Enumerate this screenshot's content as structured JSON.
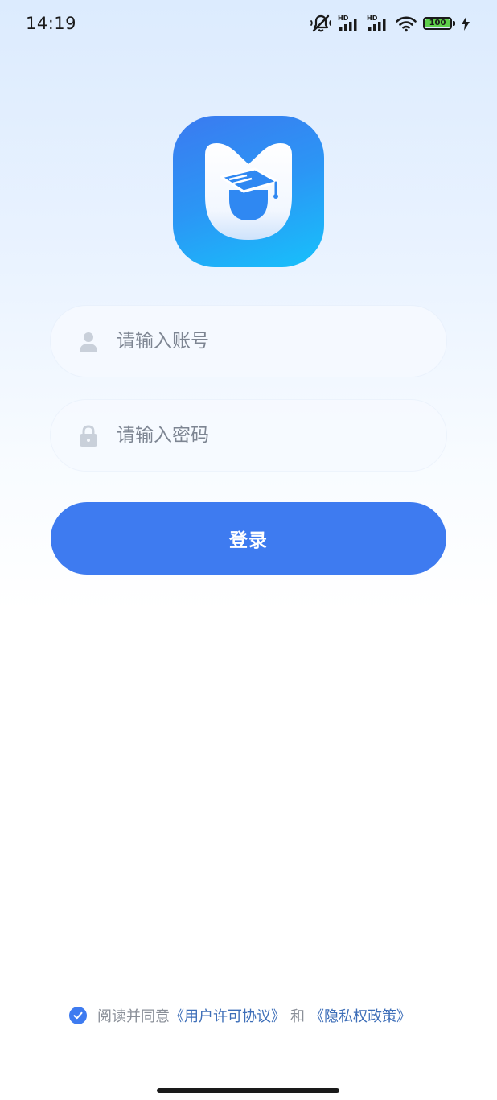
{
  "status_bar": {
    "time": "14:19",
    "battery_level": "100",
    "signal_1_label": "HD",
    "signal_2_label": "HD"
  },
  "form": {
    "account_placeholder": "请输入账号",
    "account_value": "",
    "password_placeholder": "请输入密码",
    "password_value": ""
  },
  "login_button": {
    "label": "登录"
  },
  "agreement": {
    "checked": true,
    "prefix": "阅读并同意",
    "user_license": "《用户许可协议》",
    "and": "和",
    "privacy_policy": "《隐私权政策》"
  },
  "icons": {
    "account": "user-icon",
    "password": "lock-icon",
    "logo": "graduation-cap-shield"
  },
  "colors": {
    "primary": "#3e7bf0",
    "link": "#3d6eb8",
    "battery": "#5ed04a"
  }
}
